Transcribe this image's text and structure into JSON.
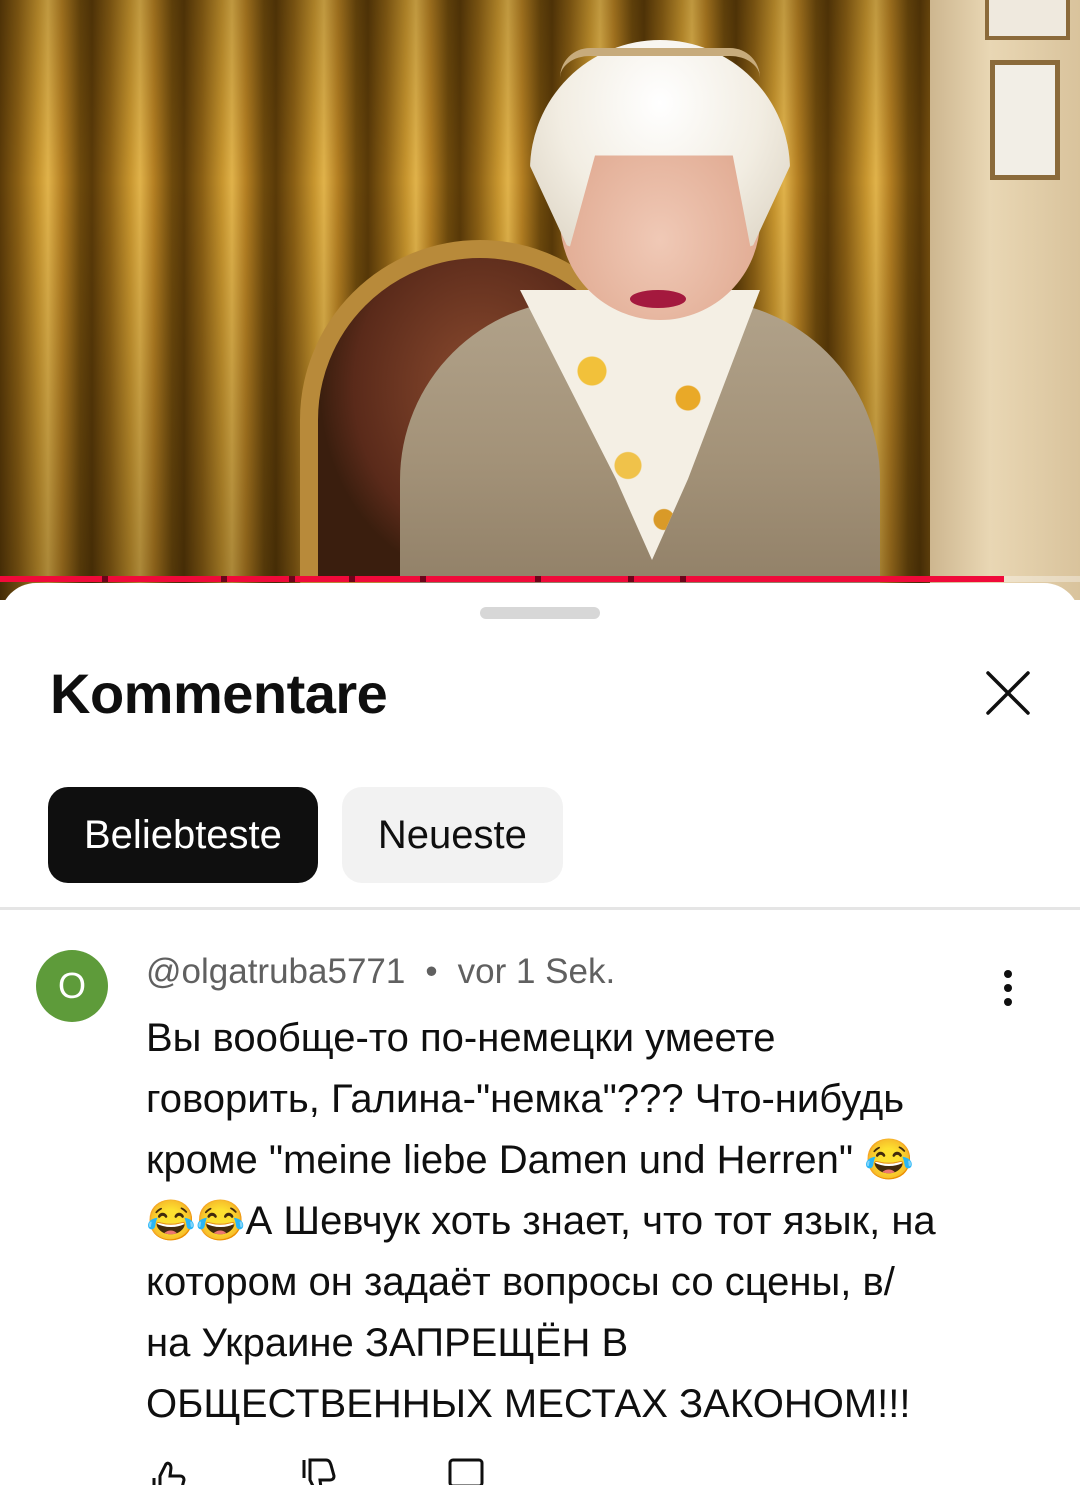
{
  "video": {
    "progress_percent": 93
  },
  "sheet": {
    "title": "Kommentare",
    "close_icon": "close-icon"
  },
  "sort_chips": [
    {
      "label": "Beliebteste",
      "active": true
    },
    {
      "label": "Neueste",
      "active": false
    }
  ],
  "comments": [
    {
      "avatar_letter": "O",
      "avatar_color": "#5e9b3a",
      "author": "@olgatruba5771",
      "time": "vor 1 Sek.",
      "text": "Вы вообще-то по-немецки умеете\nговорить, Галина-\"немка\"??? Что-нибудь\nкроме \"meine liebe Damen und Herren\" 😂\n😂😂А Шевчук хоть знает, что тот язык, на\nкотором он задаёт вопросы со сцены, в/\nна Украине ЗАПРЕЩЁН В\nОБЩЕСТВЕННЫХ МЕСТАХ ЗАКОНОМ!!!"
    }
  ],
  "colors": {
    "accent_red": "#f00a3a",
    "chip_active_bg": "#0f0f0f",
    "chip_inactive_bg": "#f2f2f2"
  }
}
